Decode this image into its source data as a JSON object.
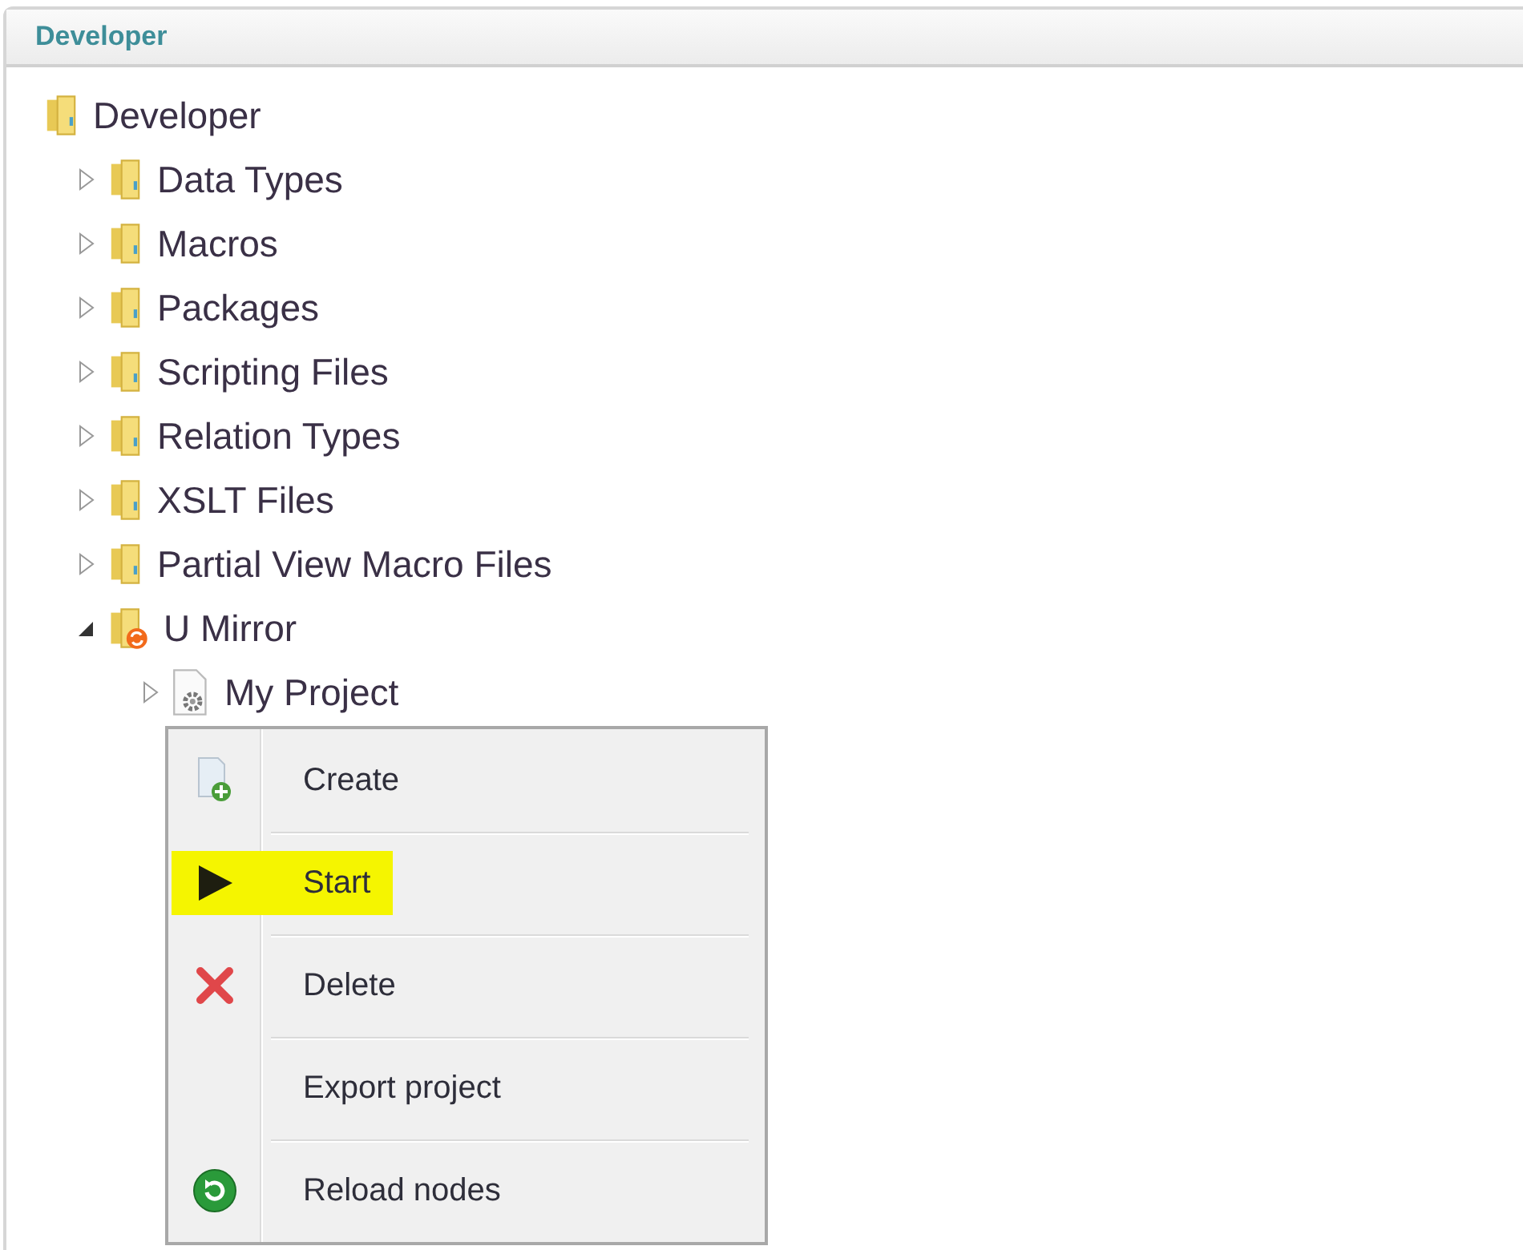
{
  "panel": {
    "title": "Developer"
  },
  "tree": {
    "label": "Developer",
    "kind": "folder",
    "children": [
      {
        "label": "Data Types",
        "kind": "folder",
        "expanded": false
      },
      {
        "label": "Macros",
        "kind": "folder",
        "expanded": false
      },
      {
        "label": "Packages",
        "kind": "folder",
        "expanded": false
      },
      {
        "label": "Scripting Files",
        "kind": "folder",
        "expanded": false
      },
      {
        "label": "Relation Types",
        "kind": "folder",
        "expanded": false
      },
      {
        "label": "XSLT Files",
        "kind": "folder",
        "expanded": false
      },
      {
        "label": "Partial View Macro Files",
        "kind": "folder",
        "expanded": false
      },
      {
        "label": "U Mirror",
        "kind": "sync-folder",
        "expanded": true,
        "children": [
          {
            "label": "My Project",
            "kind": "gear-document",
            "expanded": false
          }
        ]
      }
    ]
  },
  "context_menu": [
    {
      "label": "Create",
      "kind": "create",
      "highlighted": false
    },
    {
      "label": "Start",
      "kind": "play",
      "highlighted": true
    },
    {
      "label": "Delete",
      "kind": "delete",
      "highlighted": false
    },
    {
      "label": "Export project",
      "kind": "plain",
      "highlighted": false
    },
    {
      "label": "Reload nodes",
      "kind": "reload",
      "highlighted": false
    }
  ]
}
